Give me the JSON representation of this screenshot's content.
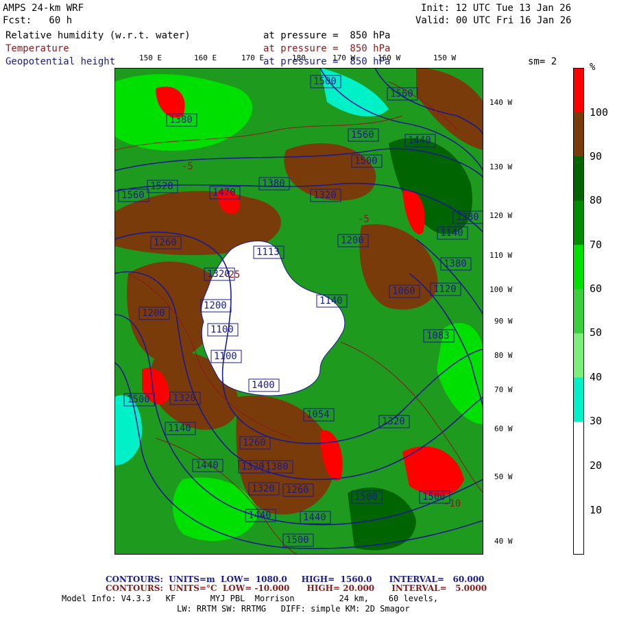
{
  "header": {
    "model": "AMPS 24-km WRF",
    "forecast": "Fcst:   60 h",
    "init": "Init: 12 UTC Tue 13 Jan 26",
    "valid": "Valid: 00 UTC Fri 16 Jan 26"
  },
  "fields": [
    {
      "name": "Relative humidity (w.r.t. water)",
      "level": "at pressure =  850 hPa",
      "color": "#000000"
    },
    {
      "name": "Temperature",
      "level": "at pressure =  850 hPa",
      "color": "#8b1a1a"
    },
    {
      "name": "Geopotential height",
      "level": "at pressure =  850 hPa",
      "color": "#1a1a8c"
    }
  ],
  "smoothing": "sm= 2",
  "top_longitudes": [
    "150 E",
    "160 E",
    "170 E",
    "180",
    "170 W",
    "160 W",
    "150 W"
  ],
  "right_longitudes": [
    "140 W",
    "130 W",
    "120 W",
    "110 W",
    "100 W",
    "90 W",
    "80 W",
    "70 W",
    "60 W",
    "50 W",
    "40 W"
  ],
  "colorbar": {
    "unit": "%",
    "ticks": [
      "100",
      "90",
      "80",
      "70",
      "60",
      "50",
      "40",
      "30",
      "20",
      "10"
    ],
    "colors": [
      "#ff0000",
      "#7a3b0a",
      "#006400",
      "#008c00",
      "#00e000",
      "#3ccf3c",
      "#7af07a",
      "#00f0c8",
      "#ffffff",
      "#ffffff",
      "#ffffff"
    ]
  },
  "height_labels": [
    "1500",
    "1560",
    "1560",
    "1500",
    "1440",
    "1380",
    "1528",
    "1470",
    "1380",
    "1320",
    "1380",
    "1260",
    "1200",
    "1113",
    "1140",
    "1200",
    "1140",
    "1060",
    "1120",
    "1380",
    "1320",
    "1200",
    "1100",
    "1100",
    "1400",
    "1320",
    "1054",
    "1140",
    "1320",
    "1500",
    "1260",
    "1440",
    "1320",
    "1380",
    "1260",
    "1320",
    "1500",
    "1440",
    "1440",
    "1500",
    "1560",
    "1500",
    "1083"
  ],
  "temp_labels": [
    "-5",
    "-25",
    "-5",
    "-10"
  ],
  "footer": {
    "contours1": {
      "prefix": "CONTOURS:",
      "units": "UNITS=m",
      "low": "LOW=  1080.0",
      "high": "HIGH=  1560.0",
      "interval": "INTERVAL=   60.000"
    },
    "contours2": {
      "prefix": "CONTOURS:",
      "units": "UNITS=°C",
      "low": "LOW= -10.000",
      "high": "HIGH= 20.000",
      "interval": "INTERVAL=   5.0000"
    },
    "model_info": "Model Info: V4.3.3   KF       MYJ PBL  Morrison         24 km,    60 levels,",
    "physics": "LW: RRTM SW: RRTMG   DIFF: simple KM: 2D Smagor"
  }
}
